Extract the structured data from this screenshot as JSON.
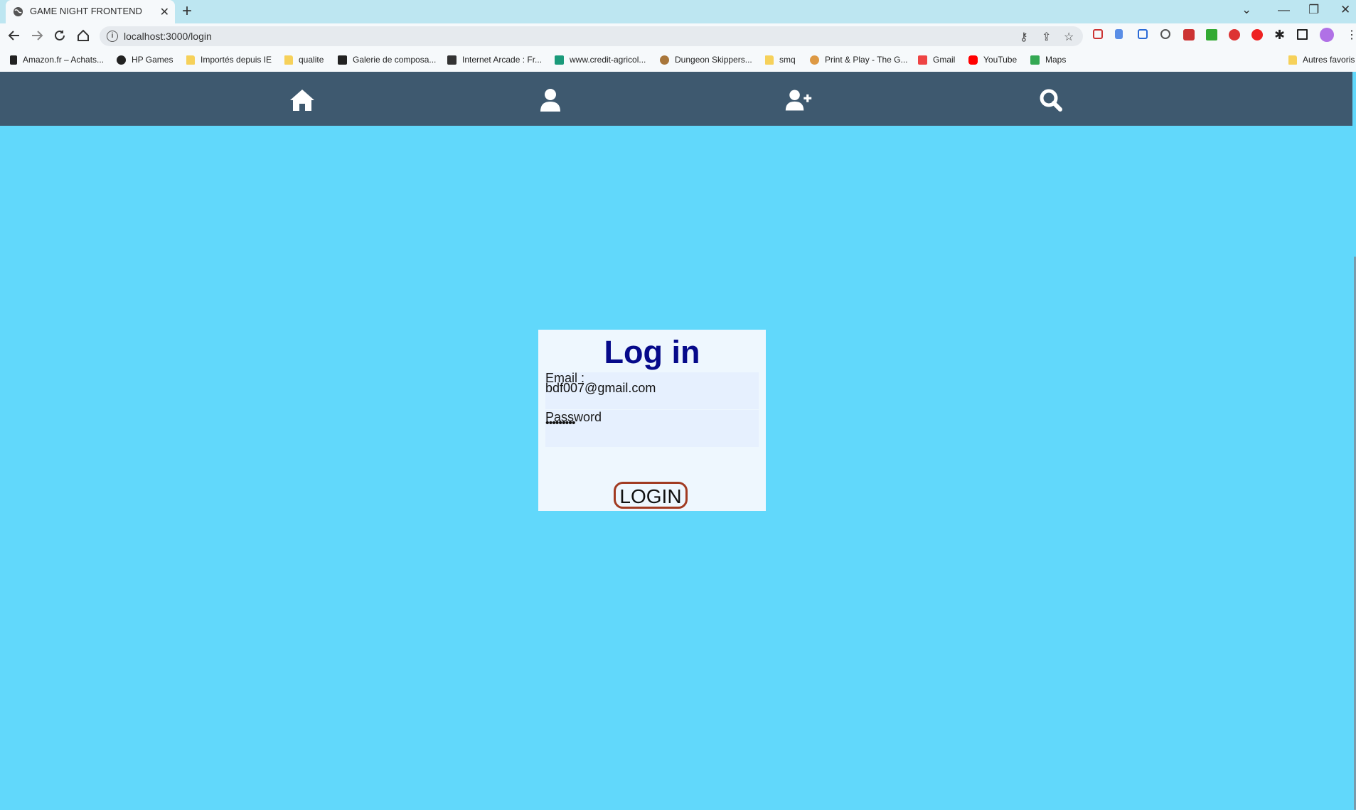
{
  "browser": {
    "tab_title": "GAME NIGHT FRONTEND",
    "tab_close": "✕",
    "new_tab": "+",
    "window_controls": [
      "⌄",
      "—",
      "❐",
      "✕"
    ],
    "url": "localhost:3000/login",
    "bookmarks": [
      {
        "label": "Amazon.fr – Achats...",
        "icon": "amazon-icon"
      },
      {
        "label": "HP Games",
        "icon": "globe-icon"
      },
      {
        "label": "Importés depuis IE",
        "icon": "folder-icon"
      },
      {
        "label": "qualite",
        "icon": "folder-icon"
      },
      {
        "label": "Galerie de composa...",
        "icon": "galerie-icon"
      },
      {
        "label": "Internet Arcade : Fr...",
        "icon": "archive-icon"
      },
      {
        "label": "www.credit-agricol...",
        "icon": "credit-agricole-icon"
      },
      {
        "label": "Dungeon Skippers...",
        "icon": "dungeon-icon"
      },
      {
        "label": "smq",
        "icon": "folder-icon"
      },
      {
        "label": "Print & Play - The G...",
        "icon": "print-play-icon"
      },
      {
        "label": "Gmail",
        "icon": "gmail-icon"
      },
      {
        "label": "YouTube",
        "icon": "youtube-icon"
      },
      {
        "label": "Maps",
        "icon": "maps-icon"
      }
    ],
    "other_bookmarks": "Autres favoris"
  },
  "app_nav": {
    "items": [
      "home-icon",
      "user-icon",
      "user-plus-icon",
      "search-icon"
    ]
  },
  "login": {
    "title": "Log in",
    "email_label": "Email :",
    "email_value": "bdf007@gmail.com",
    "password_label": "Password",
    "password_value": "•••••••••",
    "button": "LOGIN"
  },
  "colors": {
    "background": "#61d8fb",
    "navbar": "#3e596f",
    "title": "#060a8a",
    "button_border": "#a13b22"
  }
}
